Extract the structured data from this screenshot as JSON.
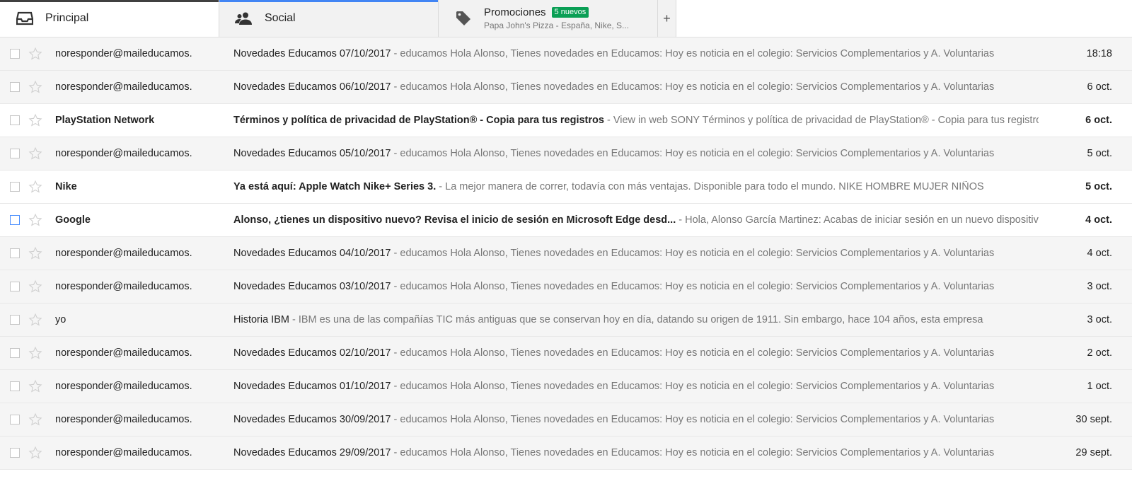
{
  "colors": {
    "principal_accent": "#404040",
    "social_accent": "#4285f4",
    "badge": "#0a9f55"
  },
  "tabs": [
    {
      "label": "Principal",
      "icon": "inbox-icon",
      "active": true
    },
    {
      "label": "Social",
      "icon": "people-icon",
      "active": false
    },
    {
      "label": "Promociones",
      "icon": "tag-icon",
      "badge": "5 nuevos",
      "subtitle": "Papa John's Pizza - España, Nike, S...",
      "active": false
    }
  ],
  "add_tab_label": "+",
  "emails": [
    {
      "sender": "noresponder@maileducamos.",
      "subject": "Novedades Educamos 07/10/2017",
      "preview": "educamos Hola Alonso, Tienes novedades en Educamos: Hoy es noticia en el colegio: Servicios Complementarios y A. Voluntarias",
      "date": "18:18",
      "unread": false
    },
    {
      "sender": "noresponder@maileducamos.",
      "subject": "Novedades Educamos 06/10/2017",
      "preview": "educamos Hola Alonso, Tienes novedades en Educamos: Hoy es noticia en el colegio: Servicios Complementarios y A. Voluntarias",
      "date": "6 oct.",
      "unread": false
    },
    {
      "sender": "PlayStation Network",
      "subject": "Términos y política de privacidad de PlayStation® - Copia para tus registros",
      "preview": "View in web SONY Términos y política de privacidad de PlayStation® - Copia para tus registros",
      "date": "6 oct.",
      "unread": true
    },
    {
      "sender": "noresponder@maileducamos.",
      "subject": "Novedades Educamos 05/10/2017",
      "preview": "educamos Hola Alonso, Tienes novedades en Educamos: Hoy es noticia en el colegio: Servicios Complementarios y A. Voluntarias",
      "date": "5 oct.",
      "unread": false
    },
    {
      "sender": "Nike",
      "subject": "Ya está aquí: Apple Watch Nike+ Series 3.",
      "preview": "La mejor manera de correr, todavía con más ventajas. Disponible para todo el mundo. NIKE HOMBRE MUJER NIÑOS",
      "date": "5 oct.",
      "unread": true
    },
    {
      "sender": "Google",
      "subject": "Alonso, ¿tienes un dispositivo nuevo? Revisa el inicio de sesión en Microsoft Edge desd...",
      "preview": "Hola, Alonso García Martinez: Acabas de iniciar sesión en un nuevo dispositivo",
      "date": "4 oct.",
      "unread": true,
      "focus": true
    },
    {
      "sender": "noresponder@maileducamos.",
      "subject": "Novedades Educamos 04/10/2017",
      "preview": "educamos Hola Alonso, Tienes novedades en Educamos: Hoy es noticia en el colegio: Servicios Complementarios y A. Voluntarias",
      "date": "4 oct.",
      "unread": false
    },
    {
      "sender": "noresponder@maileducamos.",
      "subject": "Novedades Educamos 03/10/2017",
      "preview": "educamos Hola Alonso, Tienes novedades en Educamos: Hoy es noticia en el colegio: Servicios Complementarios y A. Voluntarias",
      "date": "3 oct.",
      "unread": false
    },
    {
      "sender": "yo",
      "subject": "Historia IBM",
      "preview": "IBM es una de las compañías TIC más antiguas que se conservan hoy en día, datando su origen de 1911. Sin embargo, hace 104 años, esta empresa",
      "date": "3 oct.",
      "unread": false
    },
    {
      "sender": "noresponder@maileducamos.",
      "subject": "Novedades Educamos 02/10/2017",
      "preview": "educamos Hola Alonso, Tienes novedades en Educamos: Hoy es noticia en el colegio: Servicios Complementarios y A. Voluntarias",
      "date": "2 oct.",
      "unread": false
    },
    {
      "sender": "noresponder@maileducamos.",
      "subject": "Novedades Educamos 01/10/2017",
      "preview": "educamos Hola Alonso, Tienes novedades en Educamos: Hoy es noticia en el colegio: Servicios Complementarios y A. Voluntarias",
      "date": "1 oct.",
      "unread": false
    },
    {
      "sender": "noresponder@maileducamos.",
      "subject": "Novedades Educamos 30/09/2017",
      "preview": "educamos Hola Alonso, Tienes novedades en Educamos: Hoy es noticia en el colegio: Servicios Complementarios y A. Voluntarias",
      "date": "30 sept.",
      "unread": false
    },
    {
      "sender": "noresponder@maileducamos.",
      "subject": "Novedades Educamos 29/09/2017",
      "preview": "educamos Hola Alonso, Tienes novedades en Educamos: Hoy es noticia en el colegio: Servicios Complementarios y A. Voluntarias",
      "date": "29 sept.",
      "unread": false
    }
  ],
  "separator": " - "
}
